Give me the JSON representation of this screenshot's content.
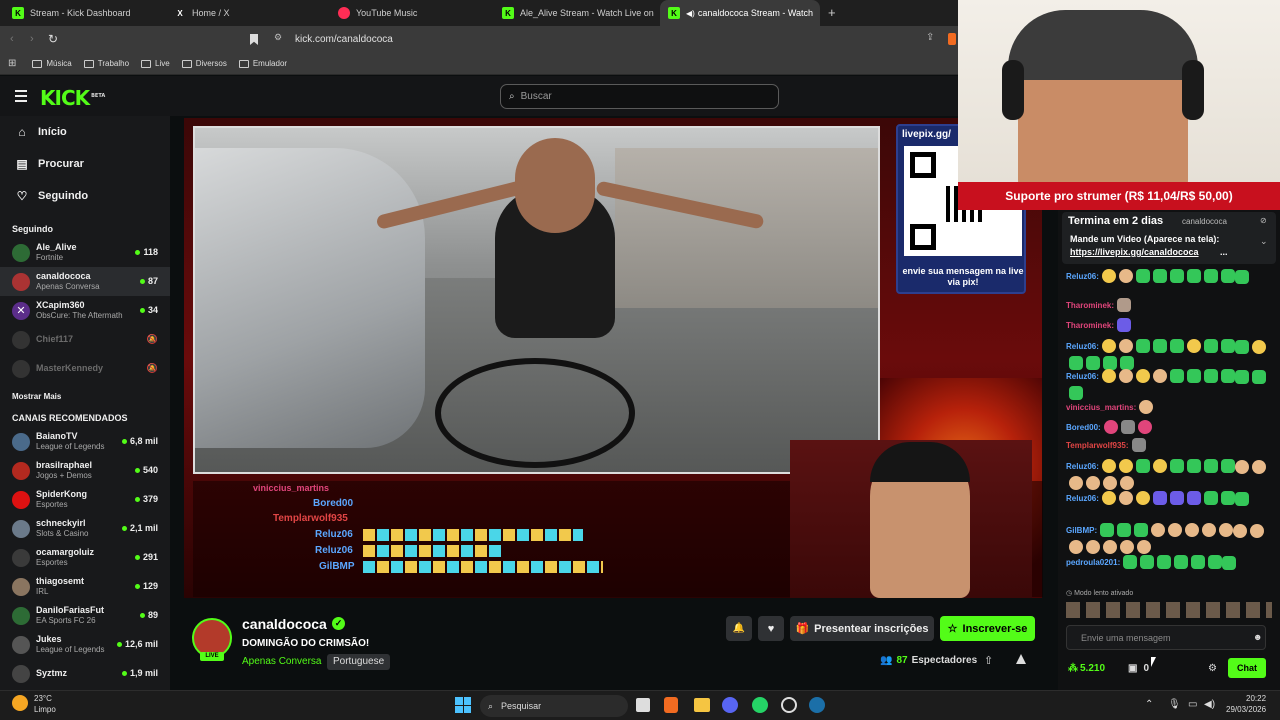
{
  "browser": {
    "tabs": [
      {
        "title": "Stream - Kick Dashboard",
        "icon": "kick-icon",
        "active": false
      },
      {
        "title": "Home / X",
        "icon": "x-icon",
        "active": false
      },
      {
        "title": "YouTube Music",
        "icon": "youtube-music-icon",
        "active": false
      },
      {
        "title": "Ale_Alive Stream - Watch Live on",
        "icon": "kick-icon",
        "active": false
      },
      {
        "title": "canaldococa Stream - Watch",
        "icon": "kick-icon",
        "active": true
      }
    ],
    "close_symbol": "✕",
    "new_tab_symbol": "+",
    "url": "kick.com/canaldococa",
    "bookmarks": [
      "Música",
      "Trabalho",
      "Live",
      "Diversos",
      "Emulador"
    ]
  },
  "header": {
    "logo": "KICK",
    "logo_badge": "BETA",
    "search_placeholder": "Buscar"
  },
  "sidebar": {
    "nav": [
      {
        "label": "Início",
        "icon": "home-icon"
      },
      {
        "label": "Procurar",
        "icon": "browse-icon"
      },
      {
        "label": "Seguindo",
        "icon": "heart-icon"
      }
    ],
    "following_title": "Seguindo",
    "following": [
      {
        "name": "Ale_Alive",
        "category": "Fortnite",
        "viewers": "118",
        "online": true
      },
      {
        "name": "canaldococa",
        "category": "Apenas Conversa",
        "viewers": "87",
        "online": true,
        "selected": true
      },
      {
        "name": "XCapim360",
        "category": "ObsCure: The Aftermath",
        "viewers": "34",
        "online": true
      },
      {
        "name": "Chief117",
        "category": "",
        "viewers": "",
        "online": false
      },
      {
        "name": "MasterKennedy",
        "category": "",
        "viewers": "",
        "online": false
      }
    ],
    "show_more": "Mostrar Mais",
    "recommended_title": "CANAIS RECOMENDADOS",
    "recommended": [
      {
        "name": "BaianoTV",
        "category": "League of Legends",
        "viewers": "6,8 mil"
      },
      {
        "name": "brasilraphael",
        "category": "Jogos + Demos",
        "viewers": "540"
      },
      {
        "name": "SpiderKong",
        "category": "Esportes",
        "viewers": "379"
      },
      {
        "name": "schneckyirl",
        "category": "Slots & Casino",
        "viewers": "2,1 mil"
      },
      {
        "name": "ocamargoluiz",
        "category": "Esportes",
        "viewers": "291"
      },
      {
        "name": "thiagosemt",
        "category": "IRL",
        "viewers": "129"
      },
      {
        "name": "DaniloFariasFut",
        "category": "EA Sports FC 26",
        "viewers": "89"
      },
      {
        "name": "Jukes",
        "category": "League of Legends",
        "viewers": "12,6 mil"
      },
      {
        "name": "Syztmz",
        "category": "",
        "viewers": "1,9 mil"
      }
    ]
  },
  "video": {
    "qr_caption_top": "livepix.gg/",
    "qr_caption": "envie sua mensagem na live via pix!",
    "overlay_chat": [
      {
        "user": "viniccius_martins",
        "color": "#e0457b"
      },
      {
        "user": "Bored00",
        "color": "#5ba7ff"
      },
      {
        "user": "Templarwolf935",
        "color": "#e04545"
      },
      {
        "user": "Reluz06",
        "color": "#5ba7ff"
      },
      {
        "user": "Reluz06",
        "color": "#5ba7ff"
      },
      {
        "user": "GilBMP",
        "color": "#5ba7ff"
      }
    ]
  },
  "channel": {
    "name": "canaldococa",
    "title": "DOMINGÃO DO CRIMSÃO!",
    "category": "Apenas Conversa",
    "language": "Portuguese",
    "live_label": "LIVE",
    "viewers": "87",
    "viewers_label": "Espectadores",
    "gift_button": "Presentear inscrições",
    "subscribe_button": "Inscrever-se"
  },
  "webcam": {
    "support_text": "Suporte pro strumer (R$ 11,04/R$ 50,00)"
  },
  "chat": {
    "pinned_overlay": "Termina em 2 dias",
    "pinned_user": "canaldococa",
    "pinned_text": "Mande um Video (Aparece na tela):",
    "pinned_link": "https://livepix.gg/canaldococa",
    "pinned_ellipsis": "...",
    "messages": [
      {
        "user": "Reluz06:",
        "color": "#5ba7ff"
      },
      {
        "user": "Tharominek:",
        "color": "#e0457b"
      },
      {
        "user": "Tharominek:",
        "color": "#e0457b"
      },
      {
        "user": "Reluz06:",
        "color": "#5ba7ff"
      },
      {
        "user": "Reluz06:",
        "color": "#5ba7ff"
      },
      {
        "user": "viniccius_martins:",
        "color": "#e0457b"
      },
      {
        "user": "Bored00:",
        "color": "#5ba7ff"
      },
      {
        "user": "Templarwolf935:",
        "color": "#e04545"
      },
      {
        "user": "Reluz06:",
        "color": "#5ba7ff"
      },
      {
        "user": "Reluz06:",
        "color": "#5ba7ff"
      },
      {
        "user": "GilBMP:",
        "color": "#5ba7ff"
      },
      {
        "user": "pedroula0201:",
        "color": "#5ba7ff"
      }
    ],
    "slow_mode": "Modo lento ativado",
    "input_placeholder": "Envie uma mensagem",
    "points": "5.210",
    "subs": "0",
    "send_button": "Chat"
  },
  "taskbar": {
    "weather_temp": "23°C",
    "weather_desc": "Limpo",
    "search_placeholder": "Pesquisar",
    "time": "20:22",
    "date": "29/03/2026"
  },
  "colors": {
    "kick_green": "#53fc18",
    "subscribe_green": "#53fc18",
    "support_red": "#c8101e"
  }
}
